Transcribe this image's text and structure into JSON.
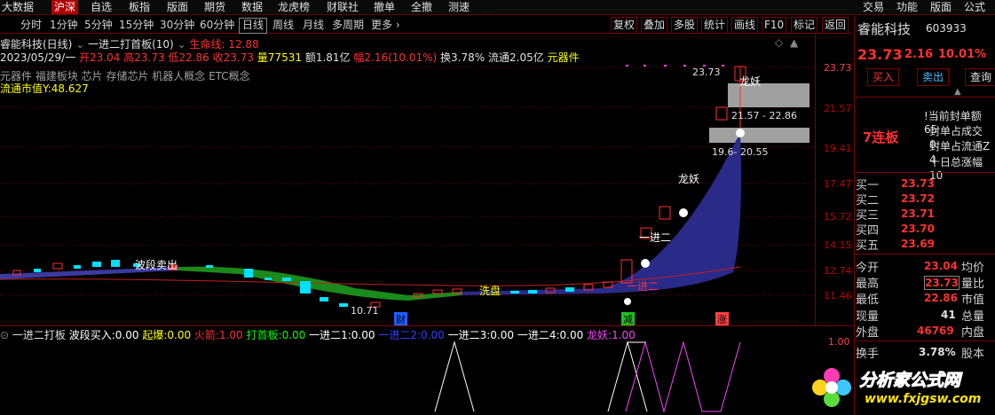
{
  "top_menu": {
    "items": [
      "大数据",
      "沪深",
      "自选",
      "板指",
      "版面",
      "期货",
      "数据",
      "龙虎榜",
      "财联社",
      "撤单",
      "全撤",
      "测速"
    ],
    "active_index": 1,
    "right_items": [
      "交易",
      "功能",
      "版面",
      "公式"
    ]
  },
  "period_bar": {
    "items": [
      "分时",
      "1分钟",
      "5分钟",
      "15分钟",
      "30分钟",
      "60分钟",
      "日线",
      "周线",
      "月线",
      "多周期",
      "更多 ›"
    ],
    "active": "日线",
    "tools": [
      "复权",
      "叠加",
      "多股",
      "统计",
      "画线",
      "F10",
      "标记",
      "返回"
    ]
  },
  "chart_header": {
    "title": "睿能科技(日线)",
    "formula": "一进二打首板(10)",
    "lifeline_label": "生命线: 12.88",
    "ohlc_line": {
      "date": "2023/05/29/一",
      "open": "开23.04",
      "high": "高23.73",
      "low": "低22.86",
      "close": "收23.73",
      "volume": "量77531",
      "amount": "额1.81亿",
      "change": "幅2.16(10.01%)",
      "turnover": "换3.78%",
      "float": "流通2.05亿",
      "industry": "元器件"
    },
    "concepts": "元器件 福建板块 芯片 存储芯片 机器人概念 ETC概念",
    "float_mv": "流通市值Y:48.627"
  },
  "price_axis": [
    "23.73",
    "21.57",
    "19.41",
    "17.47",
    "15.72",
    "14.15",
    "12.74",
    "11.46"
  ],
  "chart_annotations": {
    "top_price": "23.73",
    "longyao_top": "龙妖",
    "zone_upper": "21.57 - 22.86",
    "zone_lower": "19.6- 20.55",
    "longyao_mid": "龙妖",
    "yijiner_upper": "一进二",
    "yijiner_lower": "一进二",
    "wave_sell": "波段卖出",
    "low_price": "10.71",
    "xipan": "洗盘",
    "marker_cai": "财",
    "marker_jian": "减",
    "marker_zhang": "涨"
  },
  "indicator_header": {
    "name": "一进二打板",
    "items": [
      {
        "label": "波段买入:",
        "value": "0.00",
        "color": "#ffffff"
      },
      {
        "label": "起爆:",
        "value": "0.00",
        "color": "#ffff00"
      },
      {
        "label": "火箭:",
        "value": "1.00",
        "color": "#ff3030"
      },
      {
        "label": "打首板:",
        "value": "0.00",
        "color": "#00ff00"
      },
      {
        "label": "一进二1:",
        "value": "0.00",
        "color": "#ffffff"
      },
      {
        "label": "一进二2:",
        "value": "0.00",
        "color": "#3040ff"
      },
      {
        "label": "一进二3:",
        "value": "0.00",
        "color": "#ffffff"
      },
      {
        "label": "一进二4:",
        "value": "0.00",
        "color": "#ffffff"
      },
      {
        "label": "龙妖:",
        "value": "1.00",
        "color": "#ff40ff"
      }
    ],
    "axis_top": "1.00"
  },
  "stock_panel": {
    "name": "睿能科技",
    "code": "603933",
    "price": "23.73",
    "change": "2.16",
    "pct": "10.01%",
    "buttons": [
      "买入",
      "卖出",
      "查询"
    ],
    "board_label": "7连板",
    "seal_rows": [
      "!当前封单额 65",
      "封单占成交 0.",
      "封单占流通Z 4",
      "十日总涨幅 10"
    ],
    "bids": [
      {
        "label": "买一",
        "price": "23.73"
      },
      {
        "label": "买二",
        "price": "23.72"
      },
      {
        "label": "买三",
        "price": "23.71"
      },
      {
        "label": "买四",
        "price": "23.70"
      },
      {
        "label": "买五",
        "price": "23.69"
      }
    ],
    "stats": [
      {
        "label": "今开",
        "value": "23.04",
        "right": "均价"
      },
      {
        "label": "最高",
        "value": "23.73",
        "right": "量比"
      },
      {
        "label": "最低",
        "value": "22.86",
        "right": "市值"
      },
      {
        "label": "现量",
        "value": "41",
        "right": "总量"
      },
      {
        "label": "外盘",
        "value": "46769",
        "right": "内盘"
      }
    ],
    "turnover_label": "换手",
    "turnover_value": "3.78%",
    "turnover_right": "股本"
  },
  "watermark": {
    "text": "分析家公式网",
    "url": "www.fxjgsw.com"
  }
}
